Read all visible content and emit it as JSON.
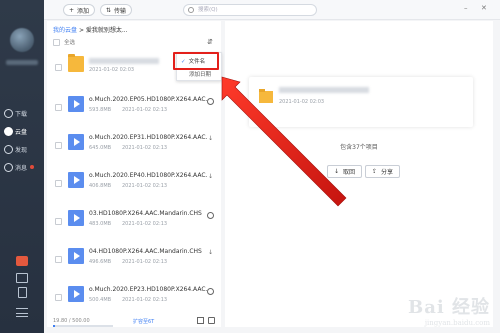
{
  "toolbar": {
    "add_label": "添加",
    "transfer_label": "传输",
    "search_placeholder": "搜索(Q)",
    "add_icon": "plus-icon",
    "transfer_icon": "transfer-arrows-icon"
  },
  "sidebar": {
    "items": [
      {
        "label": "下载",
        "icon": "download-icon"
      },
      {
        "label": "云盘",
        "icon": "cloud-icon",
        "active": true
      },
      {
        "label": "发现",
        "icon": "compass-icon"
      },
      {
        "label": "消息",
        "icon": "message-icon",
        "badge": true
      }
    ]
  },
  "breadcrumb": {
    "root": "我的云盘",
    "sep": ">",
    "current": "爱我就别想太..."
  },
  "list": {
    "select_all": "全选",
    "rows": [
      {
        "name": "",
        "blurred": true,
        "type": "folder",
        "date": "2021-01-02 02:03",
        "size": ""
      },
      {
        "name": "o.Much.2020.EP05.HD1080P.X264.AAC.",
        "type": "video",
        "size": "593.8MB",
        "date": "2021-01-02 02:13",
        "action": "play"
      },
      {
        "name": "o.Much.2020.EP31.HD1080P.X264.AAC.",
        "type": "video",
        "size": "645.0MB",
        "date": "2021-01-02 02:13",
        "action": "download"
      },
      {
        "name": "o.Much.2020.EP40.HD1080P.X264.AAC.",
        "type": "video",
        "size": "406.8MB",
        "date": "2021-01-02 02:13",
        "action": "download"
      },
      {
        "name": "03.HD1080P.X264.AAC.Mandarin.CHS",
        "type": "video",
        "size": "483.0MB",
        "date": "2021-01-02 02:13",
        "action": "play"
      },
      {
        "name": "04.HD1080P.X264.AAC.Mandarin.CHS",
        "type": "video",
        "size": "496.6MB",
        "date": "2021-01-02 02:13",
        "action": "download"
      },
      {
        "name": "o.Much.2020.EP23.HD1080P.X264.AAC.",
        "type": "video",
        "size": "500.4MB",
        "date": "2021-01-02 02:13",
        "action": "play"
      }
    ]
  },
  "footer": {
    "quota": "19.80 / 500.00",
    "quota_fraction": 0.04,
    "expand_label": "扩容至6T"
  },
  "sort_menu": {
    "options": [
      {
        "label": "文件名",
        "selected": true
      },
      {
        "label": "添加日期",
        "selected": false
      }
    ]
  },
  "detail": {
    "date": "2021-01-02 02:03",
    "count_text": "包含37个项目",
    "download_label": "取回",
    "share_label": "分享"
  },
  "watermark": {
    "text": "Bai 经验",
    "sub": "jingyan.baidu.com"
  },
  "colors": {
    "accent": "#3f7ff3",
    "highlight": "#e3201b",
    "folder": "#f6b83c",
    "video": "#5b8def"
  }
}
